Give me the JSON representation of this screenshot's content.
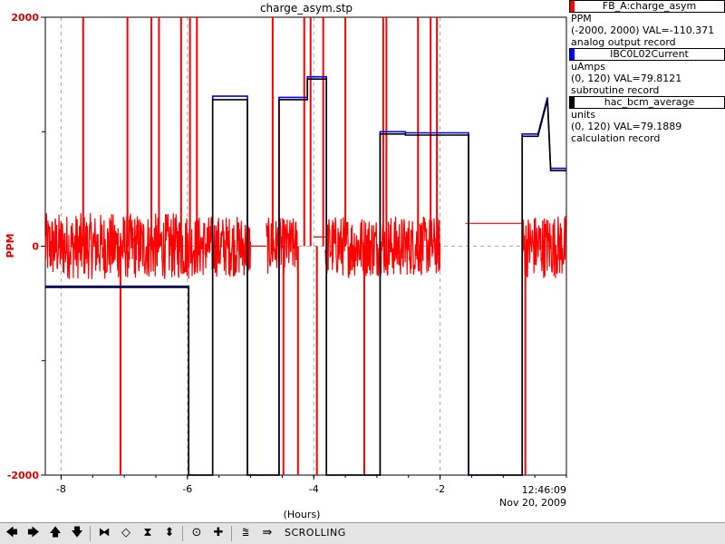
{
  "chart_data": {
    "type": "line",
    "title": "charge_asym.stp",
    "ylabel": "PPM",
    "xlabel": "(Hours)",
    "xlim": [
      -8.25,
      0
    ],
    "ylim": [
      -2000,
      2000
    ],
    "x_ticks": [
      -8,
      -6,
      -4,
      -2
    ],
    "x_tick_labels": [
      "-8",
      "-6",
      "-4",
      "-2"
    ],
    "y_tick_labels": [
      "2000",
      "0",
      "-2000"
    ],
    "y_ticks": [
      2000,
      0,
      -2000
    ],
    "end_time": "12:46:09",
    "end_date": "Nov 20, 2009",
    "grid": true,
    "series": [
      {
        "name": "FB_A:charge_asym",
        "color": "#ff0000",
        "style": "noise",
        "segments": [
          {
            "x": [
              -8.25,
              -5.98
            ],
            "center": 0,
            "amp": 290
          },
          {
            "x": [
              -5.98,
              -5.0
            ],
            "center": 0,
            "amp": 270
          },
          {
            "x": [
              -5.0,
              -4.75
            ],
            "center": 0,
            "amp": 0
          },
          {
            "x": [
              -4.75,
              -4.25
            ],
            "center": 0,
            "amp": 250
          },
          {
            "x": [
              -4.0,
              -3.8
            ],
            "center": 80,
            "amp": 0
          },
          {
            "x": [
              -3.82,
              -2.6
            ],
            "center": 0,
            "amp": 270
          },
          {
            "x": [
              -2.6,
              -2.0
            ],
            "center": 0,
            "amp": 260
          },
          {
            "x": [
              -1.6,
              -0.7
            ],
            "center": 200,
            "amp": 0
          },
          {
            "x": [
              -0.7,
              0
            ],
            "center": 0,
            "amp": 280
          }
        ],
        "spikes": [
          -7.65,
          -7.06,
          -6.95,
          -6.57,
          -6.45,
          -6.1,
          -5.96,
          -5.85,
          -4.65,
          -4.48,
          -4.25,
          -4.15,
          -4.05,
          -3.95,
          -3.85,
          -3.5,
          -3.2,
          -2.9,
          -2.85,
          -2.35,
          -2.15,
          -2.05,
          -0.65
        ]
      },
      {
        "name": "IBC0L02Current",
        "color": "#0000ff",
        "style": "steps",
        "points": [
          [
            -8.25,
            -350
          ],
          [
            -5.98,
            -350
          ],
          [
            -5.98,
            -2000
          ],
          [
            -5.6,
            -2000
          ],
          [
            -5.6,
            1310
          ],
          [
            -5.05,
            1310
          ],
          [
            -5.05,
            -2000
          ],
          [
            -4.55,
            -2000
          ],
          [
            -4.55,
            1300
          ],
          [
            -4.1,
            1300
          ],
          [
            -4.1,
            1480
          ],
          [
            -3.8,
            1480
          ],
          [
            -3.8,
            -2000
          ],
          [
            -2.95,
            -2000
          ],
          [
            -2.95,
            1000
          ],
          [
            -2.55,
            1000
          ],
          [
            -2.55,
            990
          ],
          [
            -1.55,
            990
          ],
          [
            -1.55,
            -2000
          ],
          [
            -0.7,
            -2000
          ],
          [
            -0.7,
            980
          ],
          [
            -0.45,
            980
          ],
          [
            -0.3,
            1300
          ],
          [
            -0.25,
            680
          ],
          [
            0,
            680
          ]
        ]
      },
      {
        "name": "hac_bcm_average",
        "color": "#000000",
        "style": "steps",
        "points": [
          [
            -8.25,
            -360
          ],
          [
            -5.98,
            -360
          ],
          [
            -5.98,
            -2000
          ],
          [
            -5.6,
            -2000
          ],
          [
            -5.6,
            1280
          ],
          [
            -5.05,
            1280
          ],
          [
            -5.05,
            -2000
          ],
          [
            -4.55,
            -2000
          ],
          [
            -4.55,
            1280
          ],
          [
            -4.1,
            1280
          ],
          [
            -4.1,
            1460
          ],
          [
            -3.8,
            1460
          ],
          [
            -3.8,
            -2000
          ],
          [
            -2.95,
            -2000
          ],
          [
            -2.95,
            980
          ],
          [
            -2.55,
            980
          ],
          [
            -2.55,
            970
          ],
          [
            -1.55,
            970
          ],
          [
            -1.55,
            -2000
          ],
          [
            -0.7,
            -2000
          ],
          [
            -0.7,
            960
          ],
          [
            -0.45,
            960
          ],
          [
            -0.3,
            1280
          ],
          [
            -0.25,
            660
          ],
          [
            0,
            660
          ]
        ]
      }
    ]
  },
  "legend": [
    {
      "name": "FB_A:charge_asym",
      "color": "#ff0000",
      "units": "PPM",
      "range_value": "(-2000, 2000) VAL=-110.371",
      "record": "analog output record"
    },
    {
      "name": "IBC0L02Current",
      "color": "#0000ff",
      "units": "uAmps",
      "range_value": "(0, 120) VAL=79.8121",
      "record": "subroutine record"
    },
    {
      "name": "hac_bcm_average",
      "color": "#000000",
      "units": "units",
      "range_value": "(0, 120) VAL=79.1889",
      "record": "calculation record"
    }
  ],
  "toolbar": {
    "status": "SCROLLING",
    "buttons": [
      {
        "icon": "arrow-left-icon",
        "glyph": "🡄"
      },
      {
        "icon": "arrow-right-icon",
        "glyph": "🡆"
      },
      {
        "icon": "arrow-up-icon",
        "glyph": "🡅"
      },
      {
        "icon": "arrow-down-icon",
        "glyph": "🡇"
      },
      {
        "icon": "zoom-in-x-icon",
        "glyph": "⧓"
      },
      {
        "icon": "zoom-out-x-icon",
        "glyph": "◇"
      },
      {
        "icon": "zoom-in-y-icon",
        "glyph": "⧗"
      },
      {
        "icon": "zoom-out-y-icon",
        "glyph": "⬍"
      },
      {
        "icon": "center-icon",
        "glyph": "⊙"
      },
      {
        "icon": "add-cross-icon",
        "glyph": "✚"
      },
      {
        "icon": "auto-scale-icon",
        "glyph": "⩰"
      },
      {
        "icon": "scroll-mode-icon",
        "glyph": "⇛"
      }
    ]
  }
}
